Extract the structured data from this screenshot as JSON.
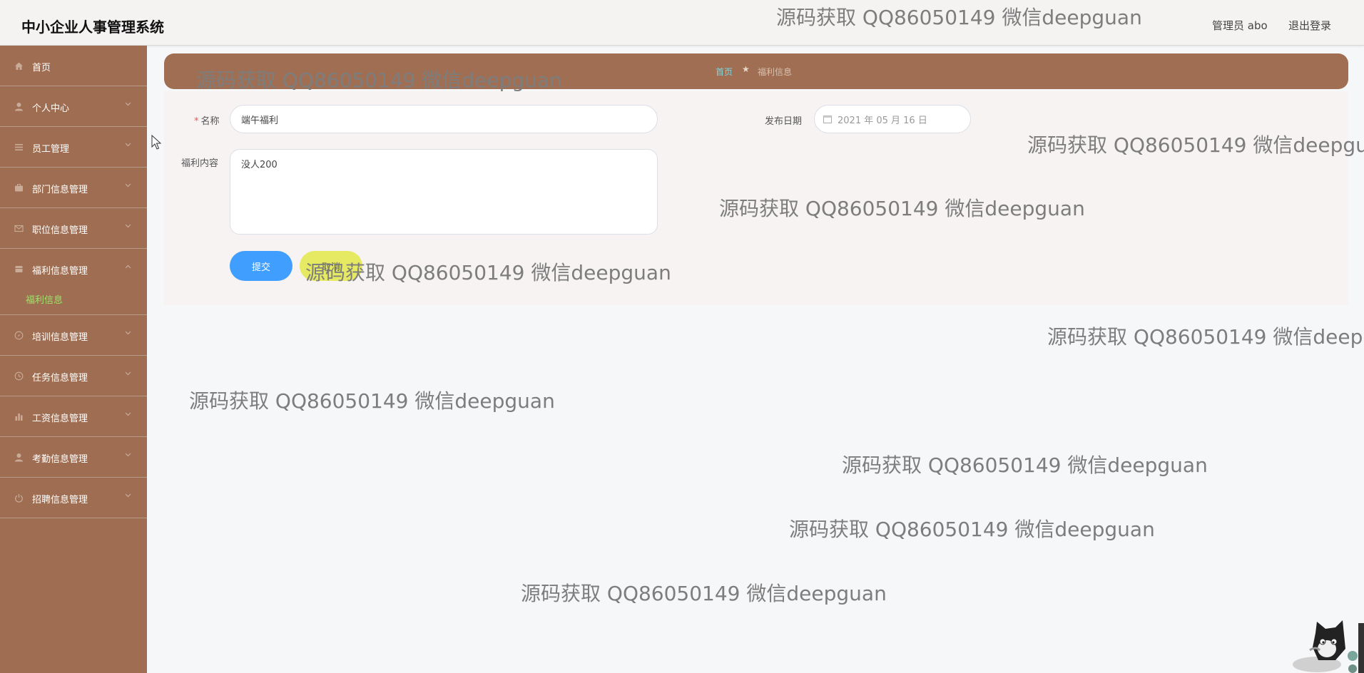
{
  "header": {
    "title": "中小企业人事管理系统",
    "user_label": "管理员 abo",
    "logout_label": "退出登录"
  },
  "sidebar": {
    "items": [
      {
        "label": "首页",
        "icon": "home-icon"
      },
      {
        "label": "个人中心",
        "icon": "user-icon"
      },
      {
        "label": "员工管理",
        "icon": "list-icon"
      },
      {
        "label": "部门信息管理",
        "icon": "briefcase-icon"
      },
      {
        "label": "职位信息管理",
        "icon": "mail-icon"
      },
      {
        "label": "福利信息管理",
        "icon": "gift-icon"
      },
      {
        "label": "培训信息管理",
        "icon": "compass-icon"
      },
      {
        "label": "任务信息管理",
        "icon": "clock-icon"
      },
      {
        "label": "工资信息管理",
        "icon": "bar-chart-icon"
      },
      {
        "label": "考勤信息管理",
        "icon": "person-icon"
      },
      {
        "label": "招聘信息管理",
        "icon": "power-icon"
      }
    ],
    "subitem": {
      "label": "福利信息"
    },
    "colors": {
      "background": "#9f6e52",
      "active_sub": "#9fe36a"
    }
  },
  "breadcrumb": {
    "home": "首页",
    "separator": "★",
    "current": "福利信息"
  },
  "form": {
    "name_label": "名称",
    "required_mark": "*",
    "name_value": "端午福利",
    "date_label": "发布日期",
    "date_value": "2021 年 05 月 16 日",
    "content_label": "福利内容",
    "content_value": "没人200",
    "submit_label": "提交",
    "cancel_label": "取消"
  },
  "watermark": {
    "text": "源码获取 QQ86050149 微信deepguan"
  },
  "colors": {
    "accent": "#409eff",
    "cancel": "#e6ea63",
    "brand": "#a06f53"
  }
}
